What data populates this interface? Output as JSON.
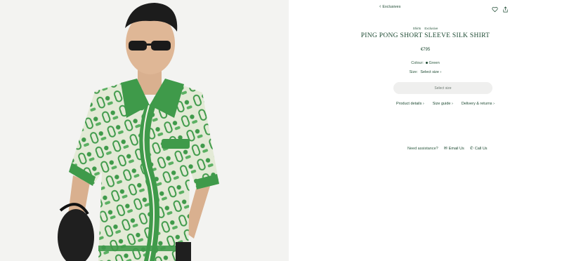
{
  "nav": {
    "back_label": "Exclusives"
  },
  "icons": {
    "wishlist": "heart-icon",
    "share": "share-icon",
    "back": "chevron-left-icon"
  },
  "product": {
    "breadcrumb": [
      "Shirts",
      "Exclusive"
    ],
    "title": "PING PONG SHORT SLEEVE SILK SHIRT",
    "price": "€795",
    "colour_label": "Colour:",
    "colour_value": "Green",
    "size_label": "Size:",
    "size_value": "Select size",
    "select_button": "Select size"
  },
  "links": {
    "details": "Product details",
    "size_guide": "Size guide",
    "delivery": "Delivery & returns"
  },
  "assistance": {
    "label": "Need assistance?",
    "email": "Email Us",
    "call": "Call Us"
  },
  "colors": {
    "brand_green": "#1d4a32",
    "shirt_green": "#3f9a4a",
    "shirt_cream": "#e9eddc",
    "button_bg": "#efefee"
  }
}
